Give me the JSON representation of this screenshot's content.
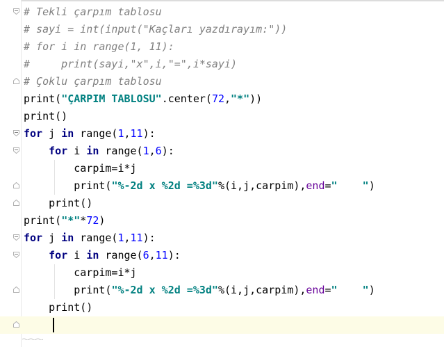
{
  "editor": {
    "language": "python",
    "lines": [
      {
        "text": "# Tekli çarpım tablosu"
      },
      {
        "text": "# sayi = int(input(\"Kaçları yazdırayım:\"))"
      },
      {
        "text": "# for i in range(1, 11):"
      },
      {
        "text": "#     print(sayi,\"x\",i,\"=\",i*sayi)"
      },
      {
        "text": "# Çoklu çarpım tablosu"
      },
      {
        "text": "print(\"ÇARPIM TABLOSU\".center(72,\"*\"))"
      },
      {
        "text": "print()"
      },
      {
        "text": "for j in range(1,11):"
      },
      {
        "text": "    for i in range(1,6):"
      },
      {
        "text": "        carpim=i*j"
      },
      {
        "text": "        print(\"%-2d x %2d =%3d\"%(i,j,carpim),end=\"    \")"
      },
      {
        "text": "    print()"
      },
      {
        "text": "print(\"*\"*72)"
      },
      {
        "text": "for j in range(1,11):"
      },
      {
        "text": "    for i in range(6,11):"
      },
      {
        "text": "        carpim=i*j"
      },
      {
        "text": "        print(\"%-2d x %2d =%3d\"%(i,j,carpim),end=\"    \")"
      },
      {
        "text": "    print()"
      },
      {
        "text": "    "
      }
    ],
    "tokens": {
      "l0": [
        "# Tekli çarpım tablosu"
      ],
      "l1": [
        "# sayi = int(input(\"Kaçları yazdırayım:\"))"
      ],
      "l2": [
        "# for i in range(1, 11):"
      ],
      "l3": [
        "#     print(sayi,\"x\",i,\"=\",i*sayi)"
      ],
      "l4": [
        "# Çoklu çarpım tablosu"
      ],
      "l5": [
        "print(",
        "\"ÇARPIM TABLOSU\"",
        ".center(",
        "72",
        ",",
        "\"*\"",
        "))"
      ],
      "l6": [
        "print()"
      ],
      "l7": [
        "for",
        " j ",
        "in",
        " range(",
        "1",
        ",",
        "11",
        "):"
      ],
      "l8": [
        "    ",
        "for",
        " i ",
        "in",
        " range(",
        "1",
        ",",
        "6",
        "):"
      ],
      "l9": [
        "        carpim=i*j"
      ],
      "l10": [
        "        print(",
        "\"%-2d x %2d =%3d\"",
        "%(i,j,carpim),",
        "end",
        "=",
        "\"    \"",
        ")"
      ],
      "l11": [
        "    print()"
      ],
      "l12": [
        "print(",
        "\"*\"",
        "*",
        "72",
        ")"
      ],
      "l13": [
        "for",
        " j ",
        "in",
        " range(",
        "1",
        ",",
        "11",
        "):"
      ],
      "l14": [
        "    ",
        "for",
        " i ",
        "in",
        " range(",
        "6",
        ",",
        "11",
        "):"
      ],
      "l15": [
        "        carpim=i*j"
      ],
      "l16": [
        "        print(",
        "\"%-2d x %2d =%3d\"",
        "%(i,j,carpim),",
        "end",
        "=",
        "\"    \"",
        ")"
      ],
      "l17": [
        "    print()"
      ]
    },
    "colors": {
      "comment": "#808080",
      "keyword": "#000080",
      "string": "#008080",
      "number": "#0000ff",
      "kwarg": "#660099",
      "current_line": "#fdfce6"
    }
  }
}
